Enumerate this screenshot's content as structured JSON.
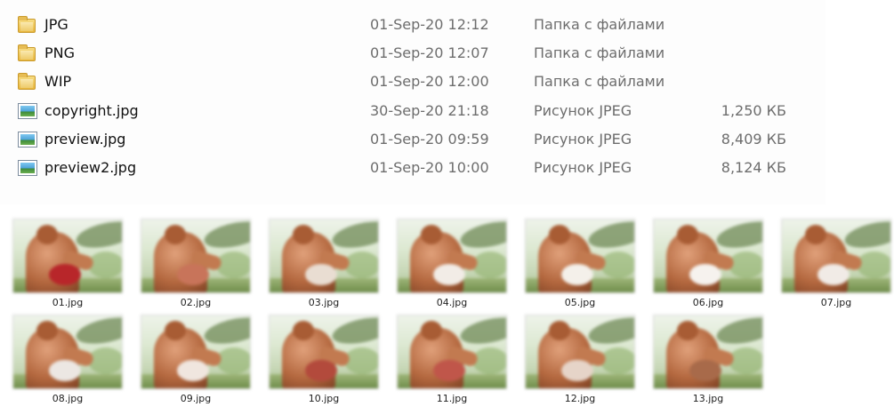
{
  "files": [
    {
      "name": "JPG",
      "icon": "folder-icon",
      "date": "01-Sep-20 12:12",
      "type": "Папка с файлами",
      "size": ""
    },
    {
      "name": "PNG",
      "icon": "folder-icon",
      "date": "01-Sep-20 12:07",
      "type": "Папка с файлами",
      "size": ""
    },
    {
      "name": "WIP",
      "icon": "folder-icon",
      "date": "01-Sep-20 12:00",
      "type": "Папка с файлами",
      "size": ""
    },
    {
      "name": "copyright.jpg",
      "icon": "image-file-icon",
      "date": "30-Sep-20 21:18",
      "type": "Рисунок JPEG",
      "size": "1,250 КБ"
    },
    {
      "name": "preview.jpg",
      "icon": "image-file-icon",
      "date": "01-Sep-20 09:59",
      "type": "Рисунок JPEG",
      "size": "8,409 КБ"
    },
    {
      "name": "preview2.jpg",
      "icon": "image-file-icon",
      "date": "01-Sep-20 10:00",
      "type": "Рисунок JPEG",
      "size": "8,124 КБ"
    }
  ],
  "thumbnails": [
    {
      "caption": "01.jpg",
      "accent": "#b8262a"
    },
    {
      "caption": "02.jpg",
      "accent": "#c8745a"
    },
    {
      "caption": "03.jpg",
      "accent": "#e9ddd2"
    },
    {
      "caption": "04.jpg",
      "accent": "#f2ece6"
    },
    {
      "caption": "05.jpg",
      "accent": "#f4f0ea"
    },
    {
      "caption": "06.jpg",
      "accent": "#f6f2ee"
    },
    {
      "caption": "07.jpg",
      "accent": "#f1ebe6"
    },
    {
      "caption": "08.jpg",
      "accent": "#ece7e3"
    },
    {
      "caption": "09.jpg",
      "accent": "#f0e6df"
    },
    {
      "caption": "10.jpg",
      "accent": "#b34a3c"
    },
    {
      "caption": "11.jpg",
      "accent": "#c0564a"
    },
    {
      "caption": "12.jpg",
      "accent": "#e6d4c8"
    },
    {
      "caption": "13.jpg",
      "accent": "#a86a4a"
    }
  ]
}
